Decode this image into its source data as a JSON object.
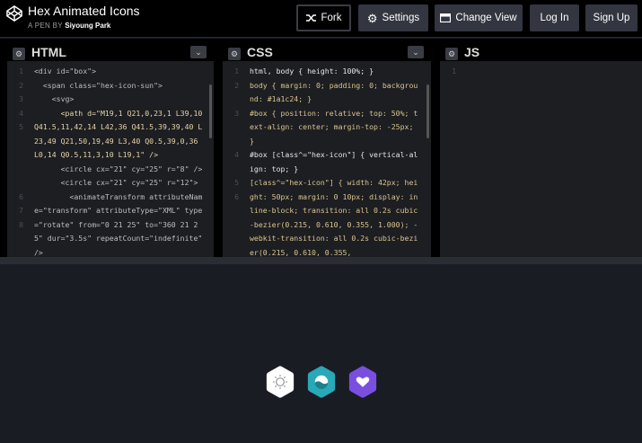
{
  "header": {
    "title": "Hex Animated Icons",
    "byline_prefix": "A PEN BY",
    "author": "Siyoung Park",
    "buttons": {
      "fork": "Fork",
      "settings": "Settings",
      "change_view": "Change View",
      "login": "Log In",
      "signup": "Sign Up"
    }
  },
  "panels": {
    "html": {
      "title": "HTML"
    },
    "css": {
      "title": "CSS"
    },
    "js": {
      "title": "JS"
    }
  },
  "html_code": {
    "line_numbers": [
      "1",
      "2",
      "3",
      "4",
      "",
      "5",
      "",
      "",
      "6",
      "7",
      "8"
    ],
    "lines": [
      "<div id=\"box\">",
      "",
      "  <span class=\"hex-icon-sun\">",
      "    <svg>",
      "      <path d=\"M19,1 Q21,0,23,1 L39,10 Q41.5,11,42,14 L42,36 Q41.5,39,39,40 L23,49 Q21,50,19,49 L3,40 Q0.5,39,0,36 L0,14 Q0.5,11,3,10 L19,1\" />",
      "      <circle cx=\"21\" cy=\"25\" r=\"8\" />",
      "      <circle cx=\"21\" cy=\"25\" r=\"12\">",
      "        <animateTransform attributeName=\"transform\" attributeType=\"XML\" type=\"rotate\" from=\"0 21 25\" to=\"360 21 25\" dur=\"3.5s\" repeatCount=\"indefinite\" />"
    ]
  },
  "css_code": {
    "lines": [
      "html, body { height: 100%; }",
      "body { margin: 0; padding: 0; background: #1a1c24; }",
      "#box { position: relative; top: 50%; text-align: center; margin-top: -25px; }",
      "#box [class^=\"hex-icon\"] { vertical-align: top; }",
      "",
      "[class^=\"hex-icon\"] { width: 42px; height: 50px; margin: 0 10px; display: inline-block; transition: all 0.2s cubic-bezier(0.215, 0.610, 0.355, 1.000); -webkit-transition: all 0.2s cubic-bezier(0.215, 0.610, 0.355,"
    ]
  },
  "js_code": {
    "line_numbers": [
      "1"
    ]
  },
  "icons": {
    "sun": {
      "name": "hex-icon-sun",
      "color": "#ffffff"
    },
    "wave": {
      "name": "hex-icon-wave",
      "color": "#29a8b8"
    },
    "heart": {
      "name": "hex-icon-heart",
      "color": "#7a4fe0"
    }
  }
}
